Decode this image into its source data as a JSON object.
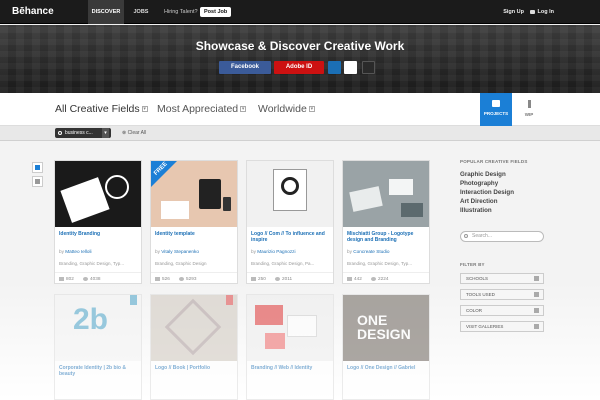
{
  "nav": {
    "logo": "Bēhance",
    "discover": "DISCOVER",
    "jobs": "JOBS",
    "hiring": "Hiring Talent?",
    "post_job": "Post Job",
    "sign_up": "Sign Up",
    "log_in": "Log In"
  },
  "hero": {
    "title": "Showcase & Discover Creative Work",
    "facebook": "Facebook",
    "adobe_id": "Adobe ID"
  },
  "filters": {
    "all_fields": "All Creative Fields",
    "most_appreciated": "Most Appreciated",
    "worldwide": "Worldwide",
    "tab_projects": "PROJECTS",
    "tab_wip": "WIP"
  },
  "search": {
    "tag": "business c...",
    "clear_all": "Clear All"
  },
  "cards": [
    {
      "title": "Identity Branding",
      "author": "Matteo Ielloli",
      "fields": "Branding, Graphic Design, Typ...",
      "likes": "802",
      "views": "4038"
    },
    {
      "title": "Identity template",
      "author": "Vitaly Stepanenko",
      "fields": "Branding, Graphic Design",
      "likes": "526",
      "views": "5293",
      "badge": "FREE"
    },
    {
      "title": "Logo // Com // To influence and inspire",
      "author": "Maurizio Pagnozzi",
      "fields": "Branding, Graphic Design, Pa...",
      "likes": "250",
      "views": "2011"
    },
    {
      "title": "Mischiatti Group - Logotype design and Branding",
      "author": "Concreate Studio",
      "fields": "Branding, Graphic Design, Typ...",
      "likes": "442",
      "views": "2224"
    },
    {
      "title": "Corporate Identity | 2b bio & beauty",
      "author": ""
    },
    {
      "title": "Logo // Book | Portfolio",
      "author": ""
    },
    {
      "title": "Branding // Web // Identity",
      "author": ""
    },
    {
      "title": "Logo // One Design // Gabriel",
      "author": ""
    }
  ],
  "sidebar": {
    "popular_head": "POPULAR CREATIVE FIELDS",
    "fields": [
      "Graphic Design",
      "Photography",
      "Interaction Design",
      "Art Direction",
      "Illustration"
    ],
    "search_placeholder": "Search...",
    "filter_head": "FILTER BY",
    "filters": [
      "SCHOOLS",
      "TOOLS USED",
      "COLOR",
      "VISIT GALLERIES"
    ]
  },
  "colors": {
    "accent": "#1b7fd6",
    "facebook": "#3b5b99",
    "adobe": "#cc1111"
  }
}
